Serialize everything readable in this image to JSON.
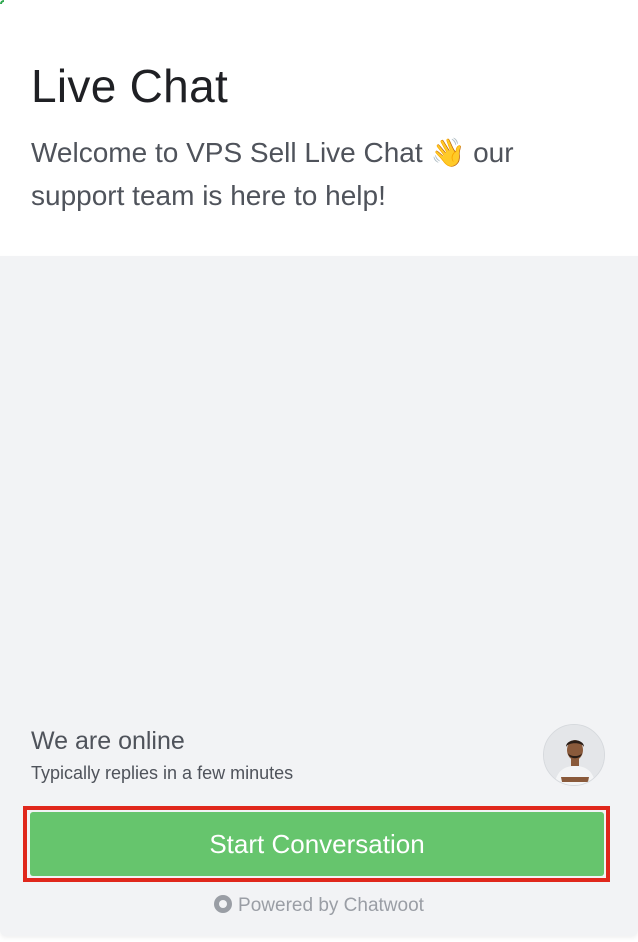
{
  "header": {
    "title": "Live Chat",
    "intro_text": "Welcome to VPS Sell Live Chat 👋 our support team is here to help!"
  },
  "team": {
    "availability_title": "We are online",
    "reply_time_text": "Typically replies in a few minutes",
    "avatar_icon": "agent-avatar"
  },
  "actions": {
    "start_label": "Start Conversation"
  },
  "branding": {
    "text": "Powered by Chatwoot",
    "icon": "chatwoot-logo-icon"
  },
  "colors": {
    "primary": "#66c56d",
    "highlight": "#e0271c",
    "body_background": "#f2f3f5"
  }
}
